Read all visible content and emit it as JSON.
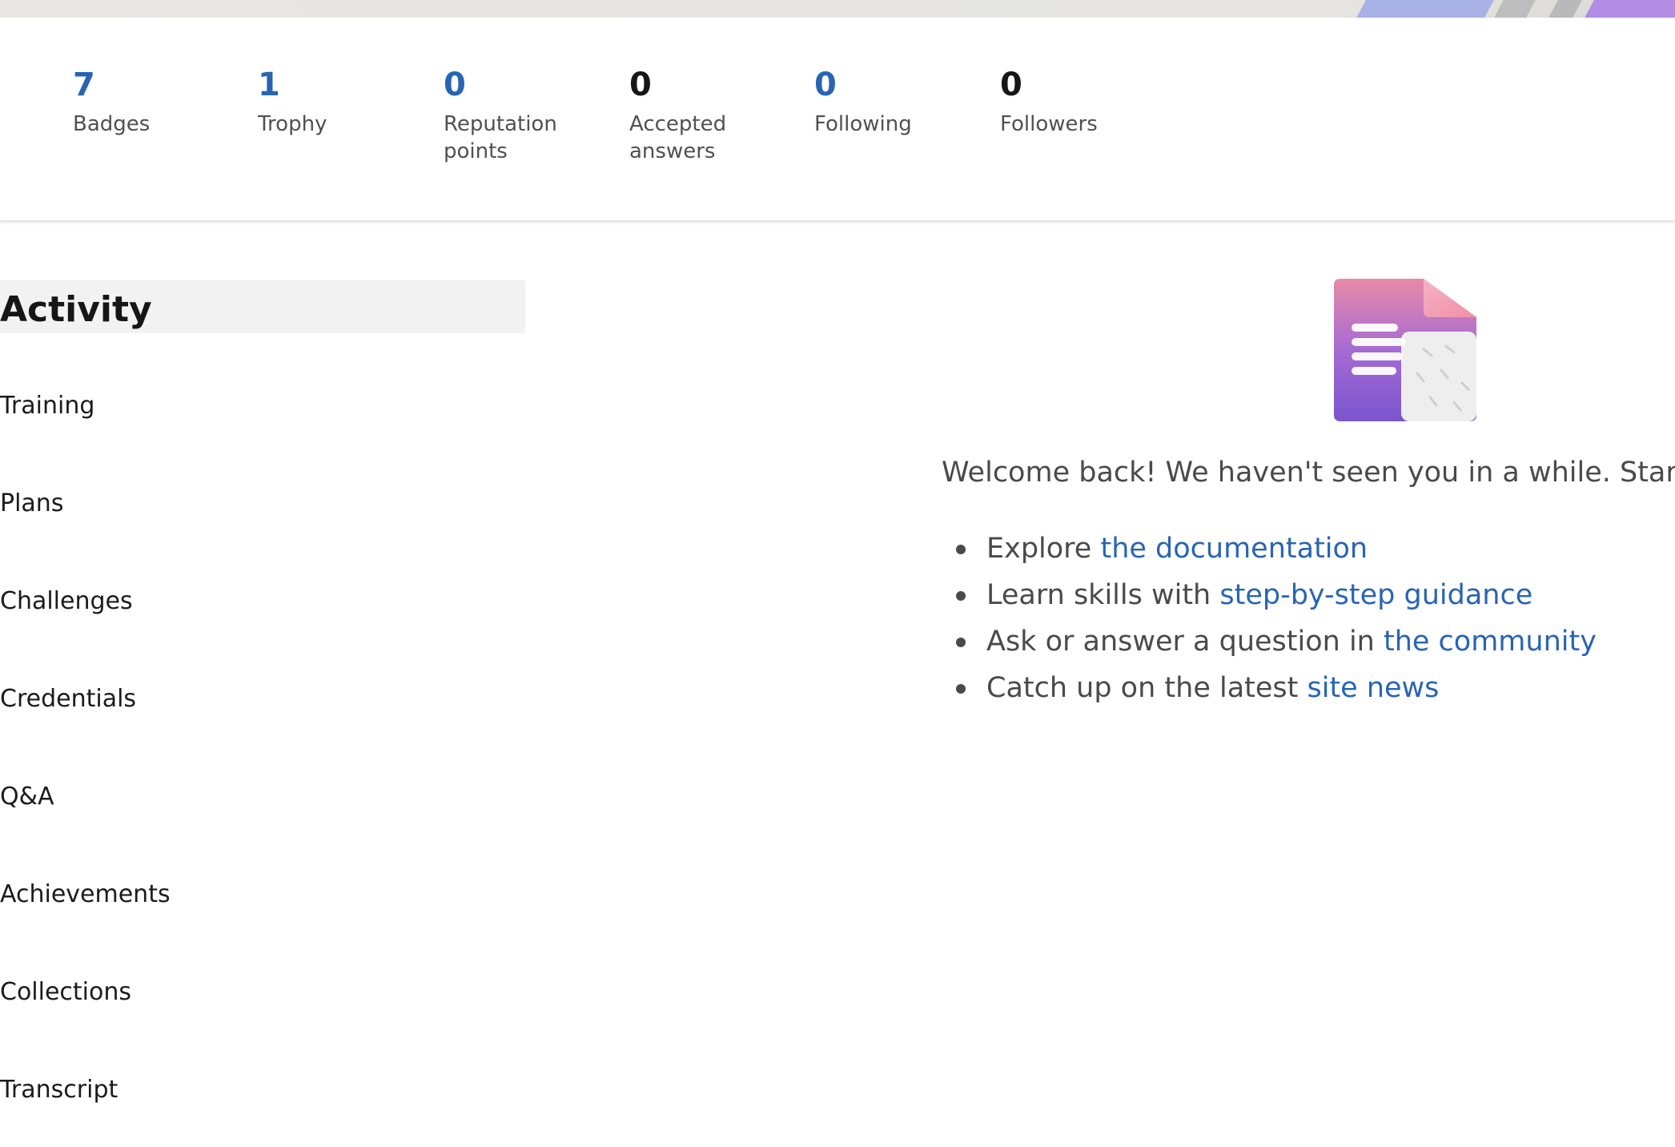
{
  "stats": [
    {
      "value": "7",
      "label": "Badges",
      "color": "#2864b4"
    },
    {
      "value": "1",
      "label": "Trophy",
      "color": "#2864b4"
    },
    {
      "value": "0",
      "label": "Reputation points",
      "color": "#2864b4"
    },
    {
      "value": "0",
      "label": "Accepted answers",
      "color": "#161616"
    },
    {
      "value": "0",
      "label": "Following",
      "color": "#2864b4"
    },
    {
      "value": "0",
      "label": "Followers",
      "color": "#161616"
    }
  ],
  "activity": {
    "heading": "Activity",
    "items": [
      {
        "label": "Training"
      },
      {
        "label": "Plans"
      },
      {
        "label": "Challenges"
      },
      {
        "label": "Credentials"
      },
      {
        "label": "Q&A"
      },
      {
        "label": "Achievements"
      },
      {
        "label": "Collections"
      },
      {
        "label": "Transcript"
      }
    ]
  },
  "welcome": {
    "icon": "document-illustration-icon",
    "text": "Welcome back! We haven't seen you in a while. Start lear",
    "bullets": [
      {
        "prefix": "Explore ",
        "link": "the documentation"
      },
      {
        "prefix": "Learn skills with ",
        "link": "step-by-step guidance"
      },
      {
        "prefix": "Ask or answer a question in ",
        "link": "the community"
      },
      {
        "prefix": "Catch up on the latest ",
        "link": "site news"
      }
    ]
  },
  "colors": {
    "link": "#2864b4",
    "text": "#4a4a4a",
    "heading_bg": "#f2f2f2"
  }
}
